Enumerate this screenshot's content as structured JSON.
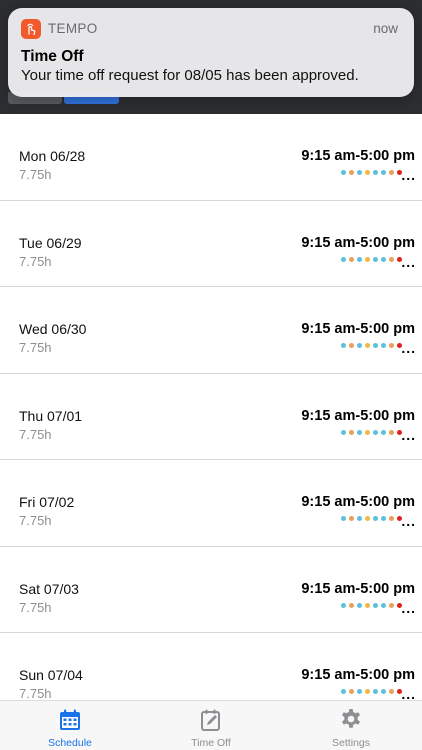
{
  "notification": {
    "app_name": "TEMPO",
    "time": "now",
    "title": "Time Off",
    "body": "Your time off request for 08/05 has been approved."
  },
  "schedule": {
    "days": [
      {
        "date": "Mon 06/28",
        "hours": "7.75h",
        "time": "9:15 am-5:00 pm",
        "more": "..."
      },
      {
        "date": "Tue 06/29",
        "hours": "7.75h",
        "time": "9:15 am-5:00 pm",
        "more": "..."
      },
      {
        "date": "Wed 06/30",
        "hours": "7.75h",
        "time": "9:15 am-5:00 pm",
        "more": "..."
      },
      {
        "date": "Thu 07/01",
        "hours": "7.75h",
        "time": "9:15 am-5:00 pm",
        "more": "..."
      },
      {
        "date": "Fri 07/02",
        "hours": "7.75h",
        "time": "9:15 am-5:00 pm",
        "more": "..."
      },
      {
        "date": "Sat 07/03",
        "hours": "7.75h",
        "time": "9:15 am-5:00 pm",
        "more": "..."
      },
      {
        "date": "Sun 07/04",
        "hours": "7.75h",
        "time": "9:15 am-5:00 pm",
        "more": "..."
      }
    ],
    "dot_colors": [
      "#5bc0de",
      "#e8a05a",
      "#5bc0de",
      "#f0b942",
      "#5bc0de",
      "#5bc0de",
      "#e8a05a",
      "#e0201e"
    ]
  },
  "tabs": [
    {
      "label": "Schedule",
      "icon": "calendar-icon",
      "active": true
    },
    {
      "label": "Time Off",
      "icon": "edit-note-icon",
      "active": false
    },
    {
      "label": "Settings",
      "icon": "gear-icon",
      "active": false
    }
  ],
  "colors": {
    "accent": "#1a73e8",
    "inactive": "#8e8e93",
    "notification_icon": "#f25a2c"
  }
}
